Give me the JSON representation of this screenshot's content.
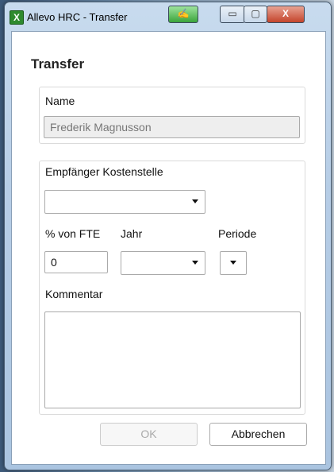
{
  "window": {
    "title": "Allevo HRC - Transfer",
    "app_icon_glyph": "X",
    "title_buttons": {
      "edit_glyph": "✍",
      "minimize_glyph": "▭",
      "maximize_glyph": "▢",
      "close_glyph": "X"
    }
  },
  "dialog": {
    "heading": "Transfer",
    "name": {
      "label": "Name",
      "value": "Frederik Magnusson"
    },
    "cost_center": {
      "label": "Empfänger Kostenstelle",
      "value": ""
    },
    "fte": {
      "label": "% von FTE",
      "value": "0"
    },
    "year": {
      "label": "Jahr",
      "value": ""
    },
    "period": {
      "label": "Periode",
      "value": ""
    },
    "comment": {
      "label": "Kommentar",
      "value": ""
    },
    "buttons": {
      "ok": "OK",
      "cancel": "Abbrechen"
    }
  },
  "colors": {
    "ok_disabled_text": "#aaaaaa",
    "name_field_bg": "#eeeeee"
  }
}
